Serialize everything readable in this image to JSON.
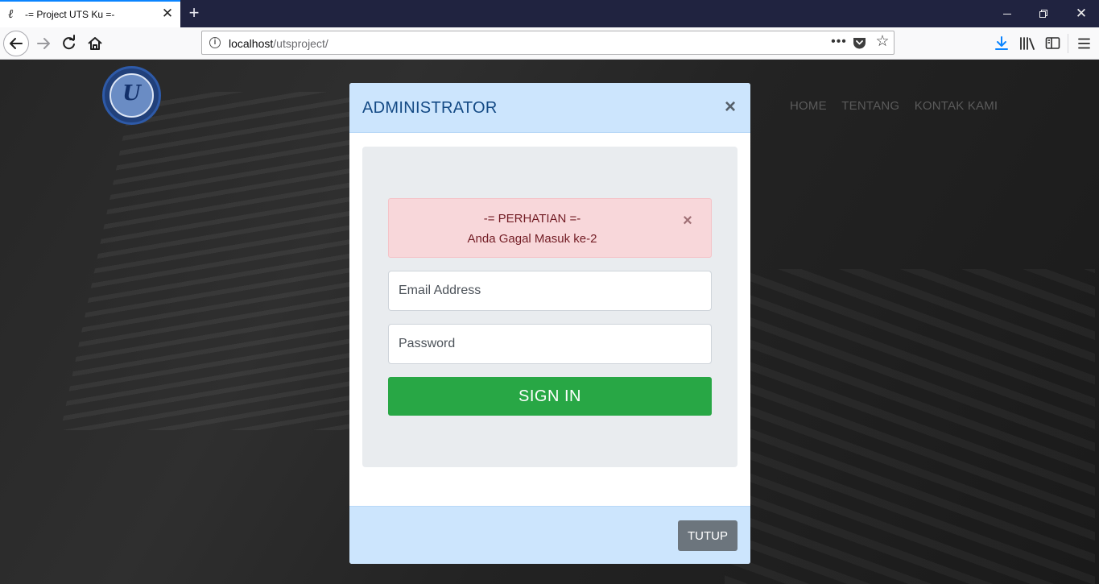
{
  "browser": {
    "tab_title": "-= Project UTS Ku =-",
    "tab_favicon": "ℓ",
    "tab_close": "✕",
    "new_tab": "+",
    "url_host": "localhost",
    "url_path": "/utsproject/",
    "url_more": "•••",
    "window_close": "✕"
  },
  "site": {
    "logo_text": "U",
    "nav": [
      {
        "label": "HOME"
      },
      {
        "label": "TENTANG"
      },
      {
        "label": "KONTAK KAMI"
      }
    ]
  },
  "modal": {
    "title": "ADMINISTRATOR",
    "close": "×",
    "alert": {
      "title": "-= PERHATIAN =-",
      "message": "Anda Gagal Masuk ke-2",
      "close": "×"
    },
    "email_placeholder": "Email Address",
    "password_placeholder": "Password",
    "signin_label": "SIGN IN",
    "footer_close_label": "TUTUP"
  },
  "colors": {
    "modal_header": "#cce5fd",
    "alert_bg": "#f8d7da",
    "signin_button": "#28a745",
    "tutup_button": "#6c757d"
  }
}
